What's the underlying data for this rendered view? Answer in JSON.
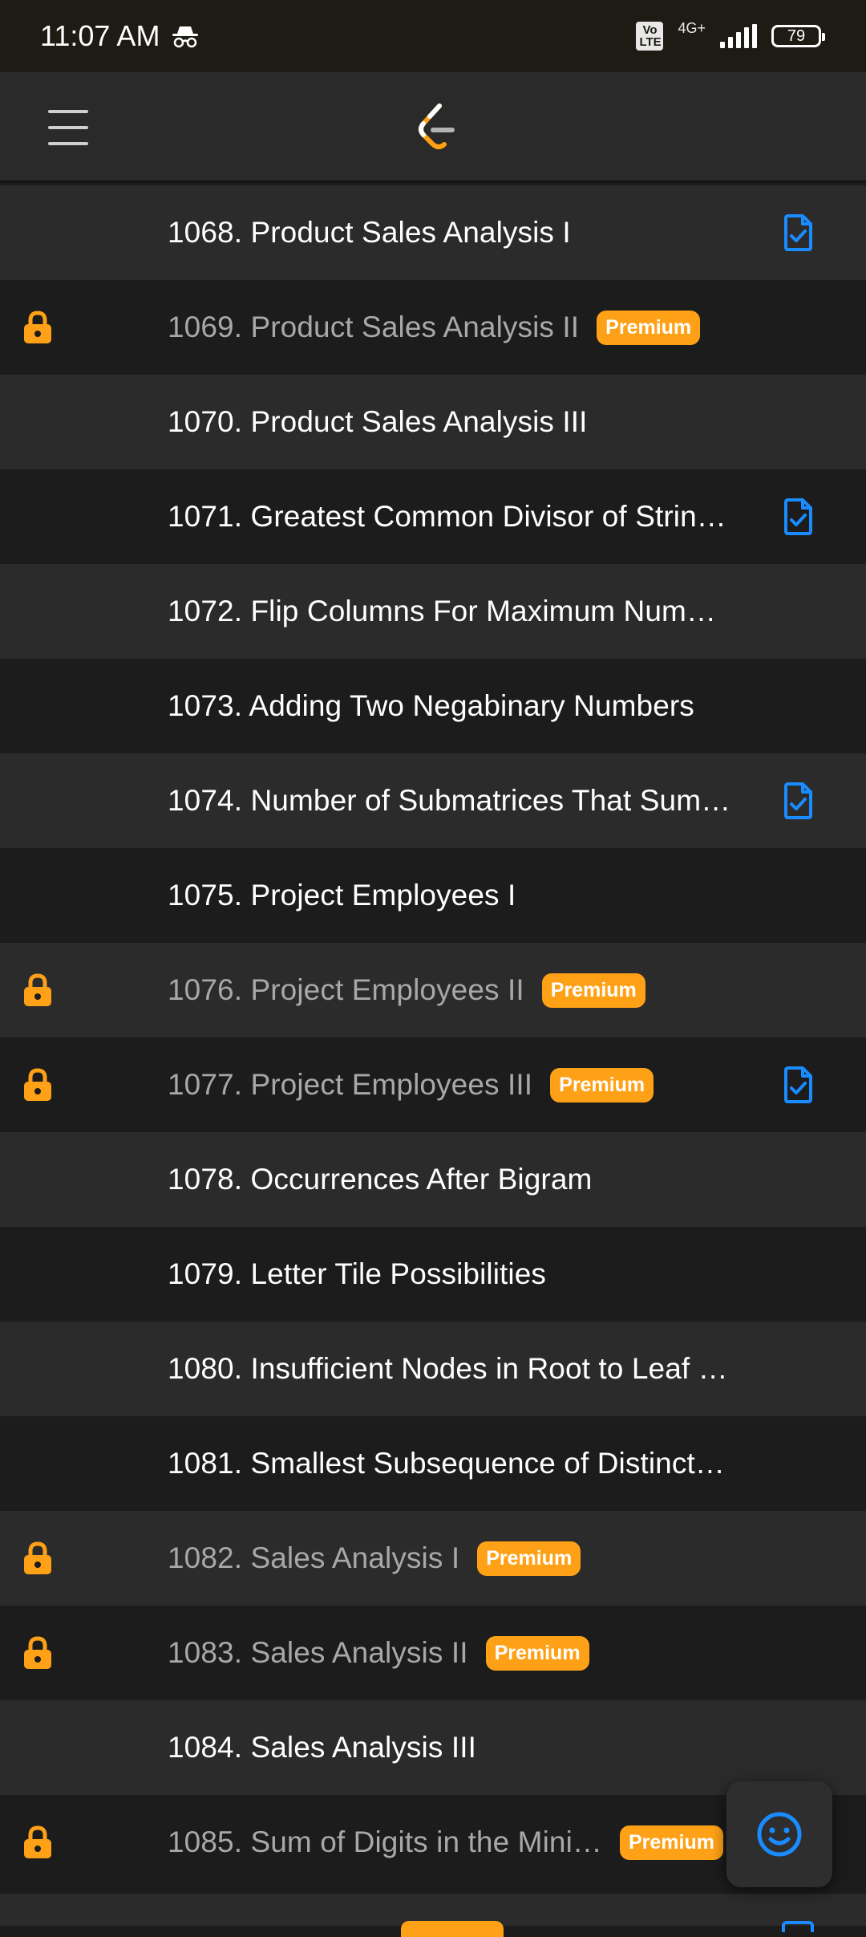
{
  "status_bar": {
    "time": "11:07 AM",
    "volte": "Vo LTE",
    "network": "4G+",
    "battery": "79"
  },
  "colors": {
    "premium": "#ffa116",
    "lock": "#ffa116",
    "solved_icon": "#1a8cff",
    "row_odd": "#2b2b2b",
    "row_even": "#1c1c1c"
  },
  "problems": [
    {
      "title": "1068. Product Sales Analysis I",
      "locked": false,
      "premium": "",
      "solved": true
    },
    {
      "title": "1069. Product Sales Analysis II",
      "locked": true,
      "premium": "Premium",
      "solved": false
    },
    {
      "title": "1070. Product Sales Analysis III",
      "locked": false,
      "premium": "",
      "solved": false
    },
    {
      "title": "1071. Greatest Common Divisor of Strin…",
      "locked": false,
      "premium": "",
      "solved": true
    },
    {
      "title": "1072. Flip Columns For Maximum Num…",
      "locked": false,
      "premium": "",
      "solved": false
    },
    {
      "title": "1073. Adding Two Negabinary Numbers",
      "locked": false,
      "premium": "",
      "solved": false
    },
    {
      "title": "1074. Number of Submatrices That Sum…",
      "locked": false,
      "premium": "",
      "solved": true
    },
    {
      "title": "1075. Project Employees I",
      "locked": false,
      "premium": "",
      "solved": false
    },
    {
      "title": "1076. Project Employees II",
      "locked": true,
      "premium": "Premium",
      "solved": false
    },
    {
      "title": "1077. Project Employees III",
      "locked": true,
      "premium": "Premium",
      "solved": true
    },
    {
      "title": "1078. Occurrences After Bigram",
      "locked": false,
      "premium": "",
      "solved": false
    },
    {
      "title": "1079. Letter Tile Possibilities",
      "locked": false,
      "premium": "",
      "solved": false
    },
    {
      "title": "1080. Insufficient Nodes in Root to Leaf …",
      "locked": false,
      "premium": "",
      "solved": false
    },
    {
      "title": "1081. Smallest Subsequence of Distinct…",
      "locked": false,
      "premium": "",
      "solved": false
    },
    {
      "title": "1082. Sales Analysis I",
      "locked": true,
      "premium": "Premium",
      "solved": false
    },
    {
      "title": "1083. Sales Analysis II",
      "locked": true,
      "premium": "Premium",
      "solved": false
    },
    {
      "title": "1084. Sales Analysis III",
      "locked": false,
      "premium": "",
      "solved": false
    },
    {
      "title": "1085. Sum of Digits in the Mini…",
      "locked": true,
      "premium": "Premium",
      "solved": false
    }
  ]
}
